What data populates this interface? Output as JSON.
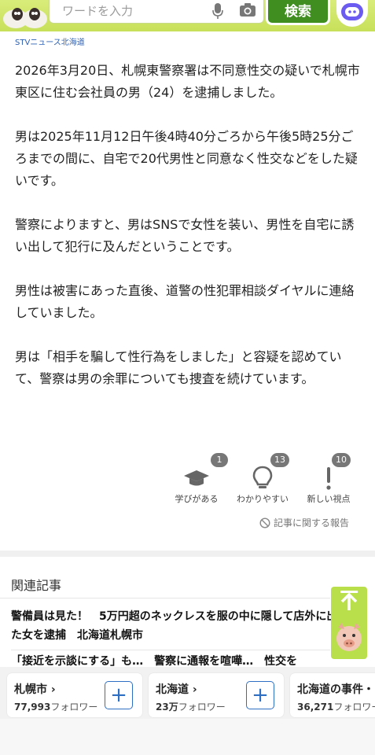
{
  "header": {
    "search_placeholder": "ワードを入力",
    "search_button": "検索"
  },
  "article": {
    "source": "STVニュース北海道",
    "paragraphs": [
      "2026年3月20日、札幌東警察署は不同意性交の疑いで札幌市東区に住む会社員の男（24）を逮捕しました。",
      "男は2025年11月12日午後4時40分ごろから午後5時25分ごろまでの間に、自宅で20代男性と同意なく性交などをした疑いです。",
      "警察によりますと、男はSNSで女性を装い、男性を自宅に誘い出して犯行に及んだということです。",
      "男性は被害にあった直後、道警の性犯罪相談ダイヤルに連絡していました。",
      "男は「相手を騙して性行為をしました」と容疑を認めていて、警察は男の余罪についても捜査を続けています。"
    ]
  },
  "reactions": [
    {
      "label": "学びがある",
      "count": "1",
      "icon": "graduation-cap-icon"
    },
    {
      "label": "わかりやすい",
      "count": "13",
      "icon": "lightbulb-icon"
    },
    {
      "label": "新しい視点",
      "count": "10",
      "icon": "exclamation-icon"
    }
  ],
  "report_label": "記事に関する報告",
  "related": {
    "heading": "関連記事",
    "items": [
      "警備員は見た！　5万円超のネックレスを服の中に隠して店外に出た女を逮捕　北海道札幌市",
      "「接近を示談にする」も…　警察に通報を喧嘩…　性交を"
    ]
  },
  "follow": [
    {
      "name": "札幌市",
      "count": "77,993",
      "suffix": "フォロワー"
    },
    {
      "name": "北海道",
      "count": "23万",
      "suffix": "フォロワー"
    },
    {
      "name": "北海道の事件・",
      "count": "36,271",
      "suffix": "フォロワー"
    }
  ],
  "colors": {
    "accent_green": "#3f8e1f",
    "header_lime": "#c7e05a",
    "link_blue": "#2e6fc4"
  }
}
